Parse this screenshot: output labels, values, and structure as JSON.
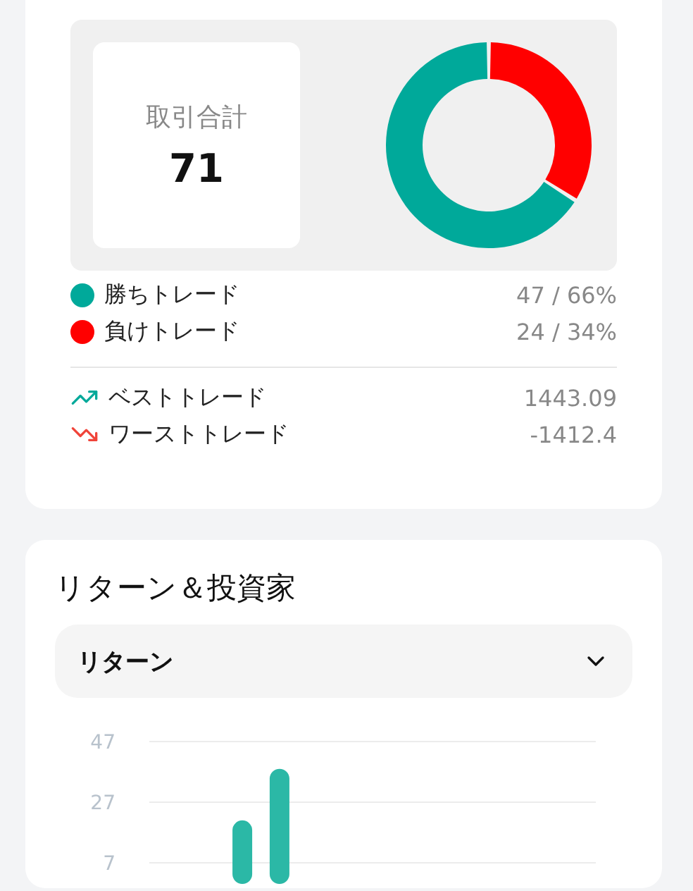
{
  "summary": {
    "total_label": "取引合計",
    "total_value": "71",
    "chart_data": {
      "type": "donut",
      "values": [
        66,
        34
      ]
    },
    "legend": [
      {
        "label": "勝ちトレード",
        "value": "47 / 66%",
        "color": "#00a99a"
      },
      {
        "label": "負けトレード",
        "value": "24 / 34%",
        "color": "#ff0000"
      }
    ],
    "extremes": [
      {
        "kind": "best",
        "label": "ベストトレード",
        "value": "1443.09"
      },
      {
        "kind": "worst",
        "label": "ワーストトレード",
        "value": "-1412.4"
      }
    ]
  },
  "returns": {
    "title": "リターン＆投資家",
    "dropdown": {
      "value": "リターン"
    },
    "chart_data": {
      "type": "bar",
      "ylim": [
        0,
        47
      ],
      "yticks": [
        7,
        27,
        47
      ],
      "values": [
        null,
        null,
        21,
        38,
        null,
        null,
        null,
        null,
        null,
        null,
        null,
        null
      ]
    }
  }
}
